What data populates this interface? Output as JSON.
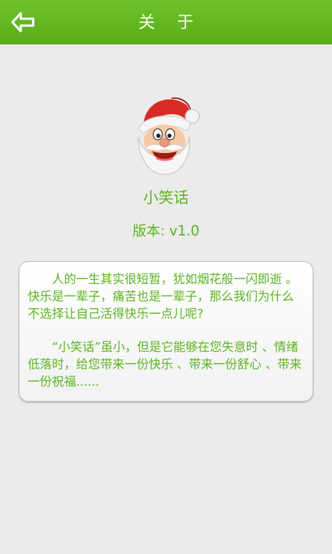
{
  "header": {
    "title": "关 于",
    "back_icon": "back-arrow-icon"
  },
  "app": {
    "logo_icon": "santa-claus-icon",
    "name": "小笑话",
    "version": "版本: v1.0"
  },
  "about": {
    "paragraphs": [
      "人的一生其实很短暂，犹如烟花般一闪即逝 。快乐是一辈子，痛苦也是一辈子，那么我们为什么不选择让自己活得快乐一点儿呢?",
      "“小笑话”虽小，但是它能够在您失意时 、情绪低落时，给您带来一份快乐 、带来一份舒心 、带来一份祝福......"
    ]
  },
  "colors": {
    "accent": "#5bb41f",
    "header_bg": "#63b823",
    "background": "#ebebeb"
  }
}
